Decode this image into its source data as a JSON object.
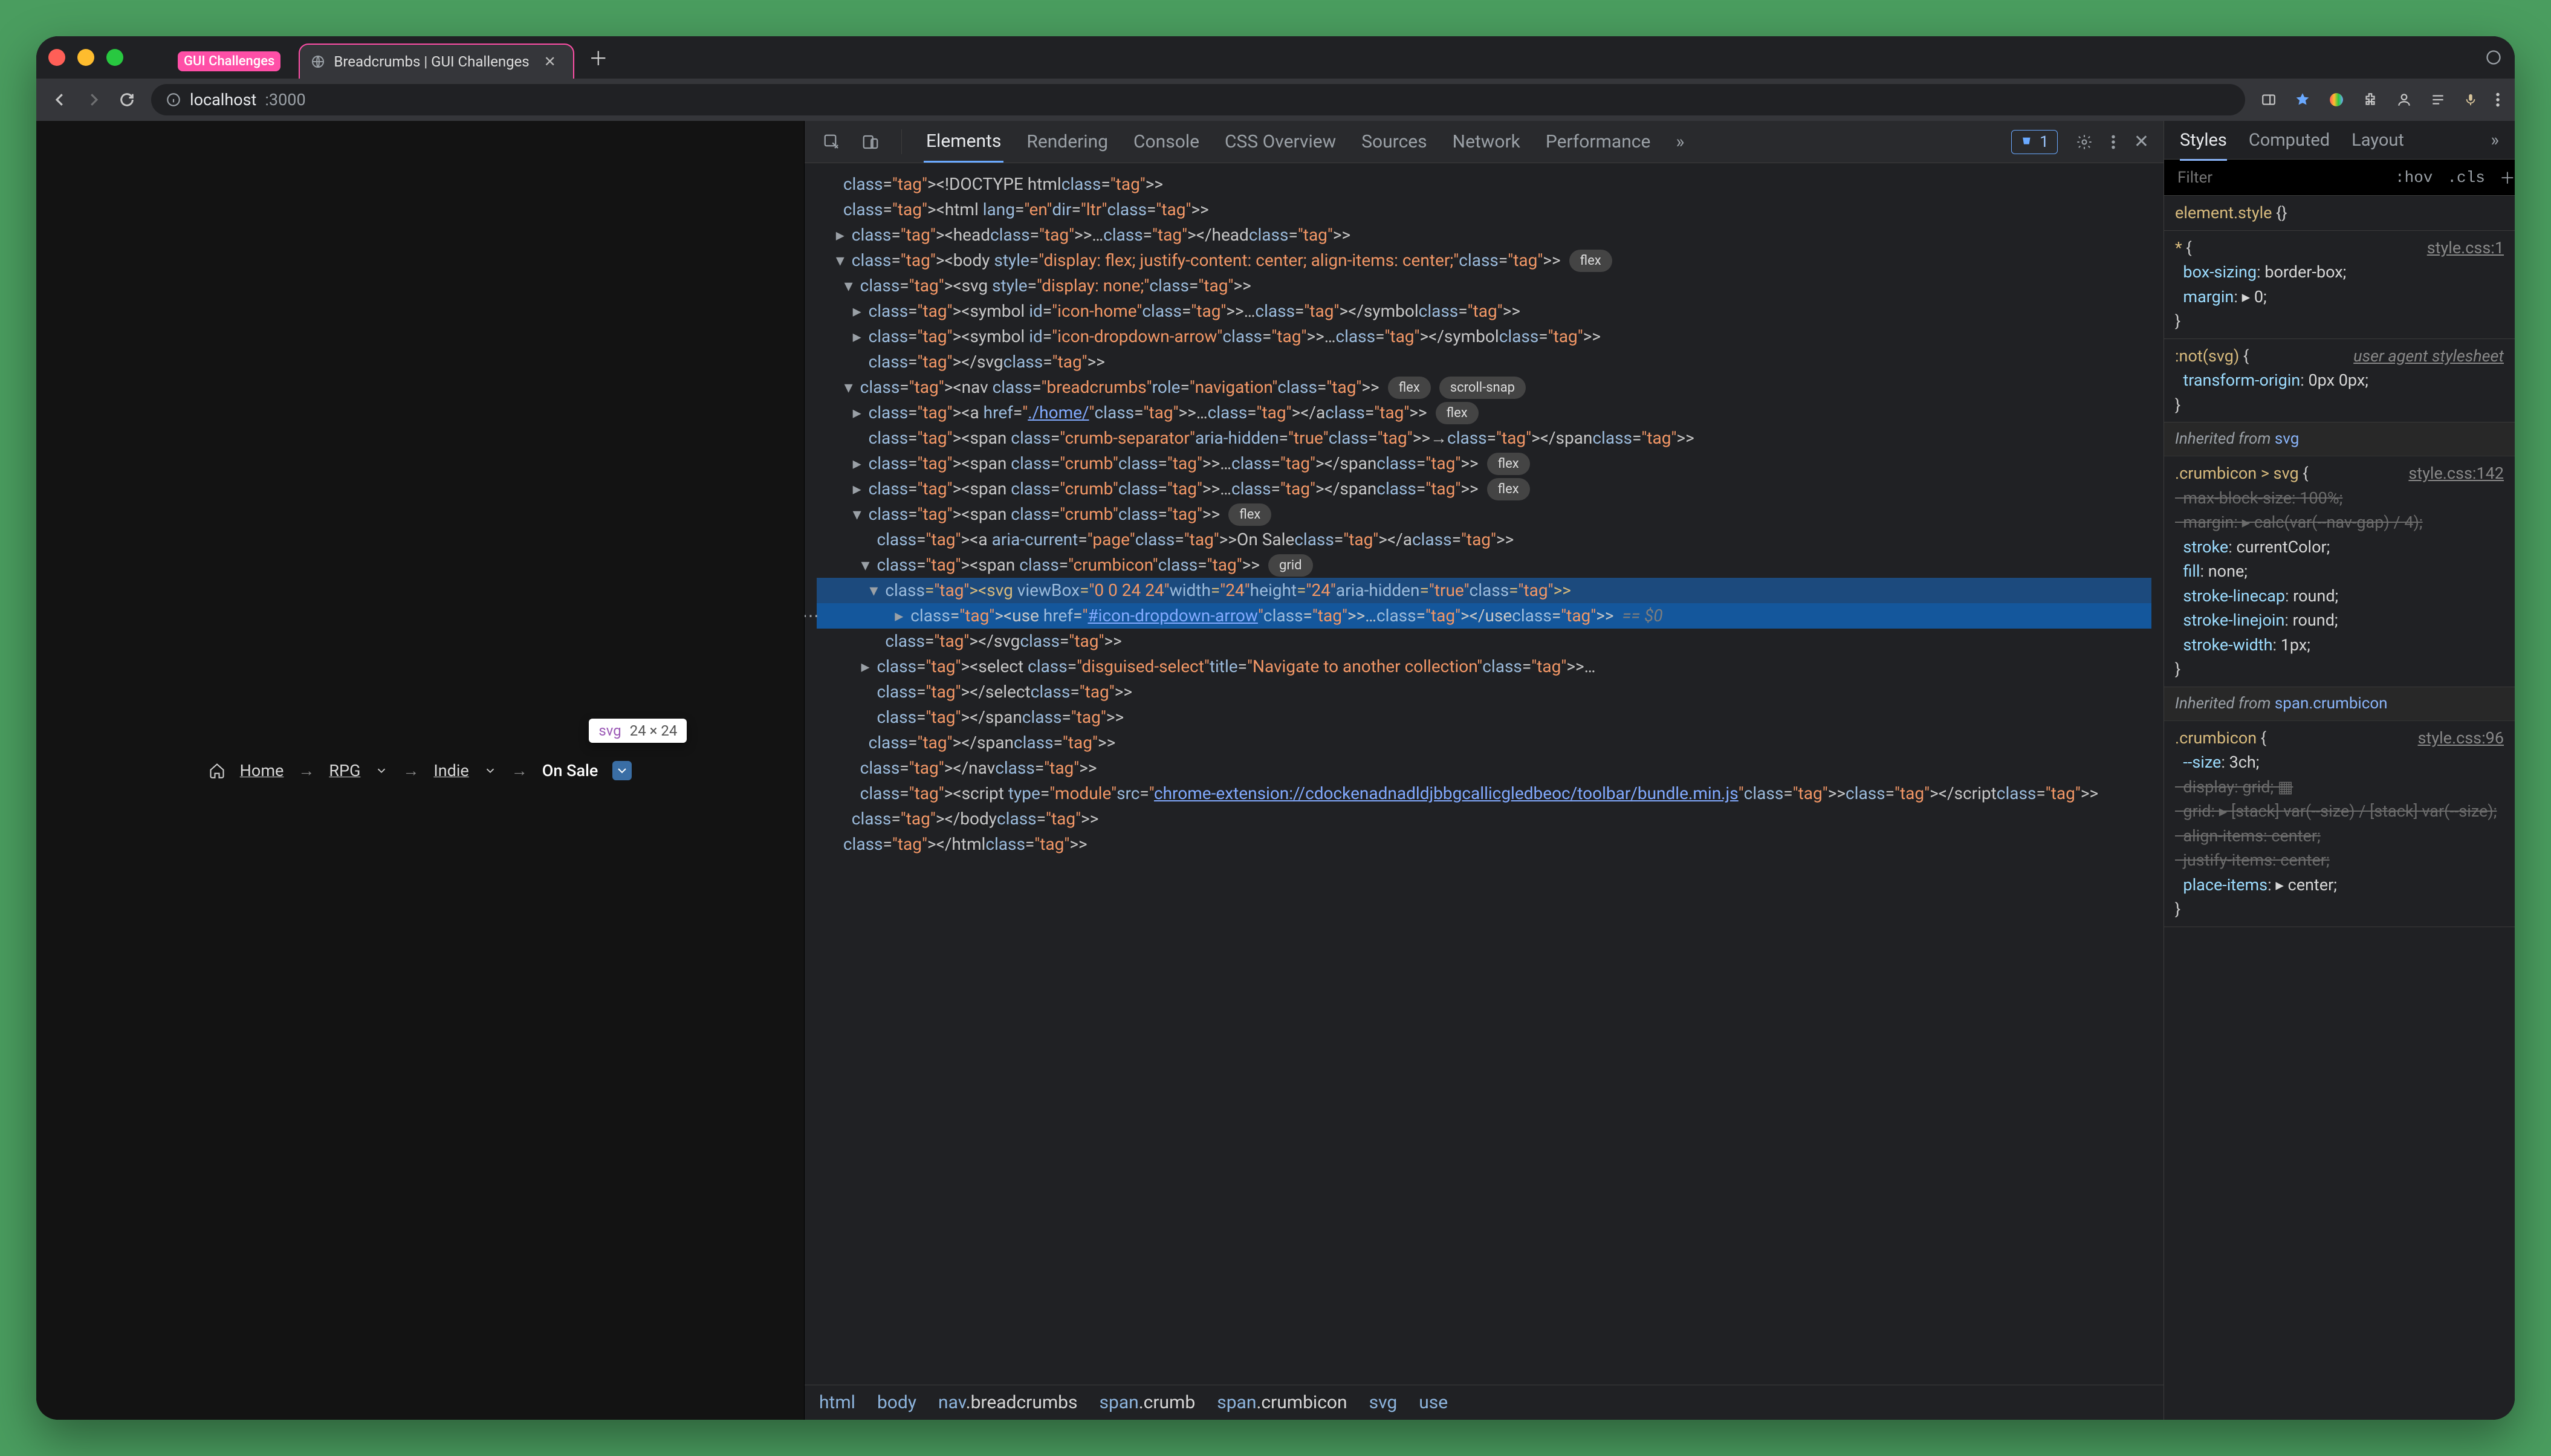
{
  "traffic_colors": [
    "#ff5f57",
    "#febc2e",
    "#28c840"
  ],
  "tabs": [
    {
      "badge_label": "GUI Challenges",
      "active": false
    },
    {
      "label": "Breadcrumbs | GUI Challenges",
      "active": true
    }
  ],
  "address": {
    "protocol_icon": "info",
    "host": "localhost",
    "port": ":3000"
  },
  "toolbar_icons": [
    "panel",
    "star",
    "color-wheel",
    "extensions",
    "profile",
    "reading-list",
    "mic",
    "more"
  ],
  "page": {
    "hover_tip": {
      "element": "svg",
      "dims": "24 × 24"
    },
    "breadcrumbs": {
      "home": "Home",
      "items": [
        "RPG",
        "Indie"
      ],
      "current": "On Sale"
    }
  },
  "devtools": {
    "tabs": [
      "Elements",
      "Rendering",
      "Console",
      "CSS Overview",
      "Sources",
      "Network",
      "Performance"
    ],
    "active_tab": "Elements",
    "issues_count": "1",
    "dom_lines": [
      {
        "indent": 0,
        "pre": "",
        "html": "<!DOCTYPE html>"
      },
      {
        "indent": 0,
        "pre": "",
        "html": "<html lang=\"en\" dir=\"ltr\">"
      },
      {
        "indent": 1,
        "pre": "▸",
        "html": "<head>…</head>"
      },
      {
        "indent": 1,
        "pre": "▾",
        "html": "<body style=\"display: flex; justify-content: center; align-items: center;\">",
        "pills": [
          "flex"
        ]
      },
      {
        "indent": 2,
        "pre": "▾",
        "html": "<svg style=\"display: none;\">"
      },
      {
        "indent": 3,
        "pre": "▸",
        "html": "<symbol id=\"icon-home\">…</symbol>"
      },
      {
        "indent": 3,
        "pre": "▸",
        "html": "<symbol id=\"icon-dropdown-arrow\">…</symbol>"
      },
      {
        "indent": 3,
        "pre": "",
        "html": "</svg>"
      },
      {
        "indent": 2,
        "pre": "▾",
        "html": "<nav class=\"breadcrumbs\" role=\"navigation\">",
        "pills": [
          "flex",
          "scroll-snap"
        ]
      },
      {
        "indent": 3,
        "pre": "▸",
        "html": "<a href=\"./home/\">…</a>",
        "pills": [
          "flex"
        ],
        "link": "./home/"
      },
      {
        "indent": 3,
        "pre": "",
        "html": "<span class=\"crumb-separator\" aria-hidden=\"true\">→</span>"
      },
      {
        "indent": 3,
        "pre": "▸",
        "html": "<span class=\"crumb\">…</span>",
        "pills": [
          "flex"
        ]
      },
      {
        "indent": 3,
        "pre": "▸",
        "html": "<span class=\"crumb\">…</span>",
        "pills": [
          "flex"
        ]
      },
      {
        "indent": 3,
        "pre": "▾",
        "html": "<span class=\"crumb\">",
        "pills": [
          "flex"
        ]
      },
      {
        "indent": 4,
        "pre": "",
        "html": "<a aria-current=\"page\">On Sale</a>"
      },
      {
        "indent": 4,
        "pre": "▾",
        "html": "<span class=\"crumbicon\">",
        "pills": [
          "grid"
        ]
      },
      {
        "indent": 5,
        "pre": "▾",
        "html": "<svg viewBox=\"0 0 24 24\" width=\"24\" height=\"24\" aria-hidden=\"true\">",
        "sel": true
      },
      {
        "indent": 6,
        "pre": "▸",
        "html": "<use href=\"#icon-dropdown-arrow\">…</use>  == $0",
        "sel_strong": true,
        "link": "#icon-dropdown-arrow",
        "gutter": "⋯"
      },
      {
        "indent": 5,
        "pre": "",
        "html": "</svg>"
      },
      {
        "indent": 4,
        "pre": "▸",
        "html": "<select class=\"disguised-select\" title=\"Navigate to another collection\">…"
      },
      {
        "indent": 4,
        "pre": "",
        "html": "</select>"
      },
      {
        "indent": 4,
        "pre": "",
        "html": "</span>"
      },
      {
        "indent": 3,
        "pre": "",
        "html": "</span>"
      },
      {
        "indent": 2,
        "pre": "",
        "html": "</nav>"
      },
      {
        "indent": 2,
        "pre": "",
        "html": "<script type=\"module\" src=\"chrome-extension://cdockenadnadldjbbgcallicgledbeoc/toolbar/bundle.min.js\"></script>",
        "link": "chrome-extension://cdockenadnadldjbbgcallicgledbeoc/toolbar/bundle.min.js"
      },
      {
        "indent": 1,
        "pre": "",
        "html": "</body>"
      },
      {
        "indent": 0,
        "pre": "",
        "html": "</html>"
      }
    ],
    "path": [
      "html",
      "body",
      "nav.breadcrumbs",
      "span.crumb",
      "span.crumbicon",
      "svg",
      "use"
    ]
  },
  "styles": {
    "tabs": [
      "Styles",
      "Computed",
      "Layout"
    ],
    "active": "Styles",
    "filter_placeholder": "Filter",
    "hov": ":hov",
    "cls": ".cls",
    "rules": [
      {
        "selector": "element.style",
        "src": "",
        "decls": []
      },
      {
        "selector": "*",
        "src": "style.css:1",
        "decls": [
          {
            "prop": "box-sizing",
            "val": "border-box;"
          },
          {
            "prop": "margin",
            "val": "▸ 0;"
          }
        ]
      },
      {
        "selector": ":not(svg)",
        "src": "user agent stylesheet",
        "ua": true,
        "decls": [
          {
            "prop": "transform-origin",
            "val": "0px 0px;"
          }
        ]
      }
    ],
    "inherited": [
      {
        "from": "svg",
        "selector": ".crumbicon > svg",
        "src": "style.css:142",
        "decls": [
          {
            "prop": "max-block-size",
            "val": "100%;",
            "struck": true
          },
          {
            "prop": "margin",
            "val": "▸ calc(var(--nav-gap) / 4);",
            "struck": true
          },
          {
            "prop": "stroke",
            "val": "currentColor;"
          },
          {
            "prop": "fill",
            "val": "none;"
          },
          {
            "prop": "stroke-linecap",
            "val": "round;"
          },
          {
            "prop": "stroke-linejoin",
            "val": "round;"
          },
          {
            "prop": "stroke-width",
            "val": "1px;"
          }
        ]
      },
      {
        "from": "span.crumbicon",
        "selector": ".crumbicon",
        "src": "style.css:96",
        "decls": [
          {
            "prop": "--size",
            "val": "3ch;"
          },
          {
            "prop": "display",
            "val": "grid; ▦",
            "struck": true
          },
          {
            "prop": "grid",
            "val": "▸ [stack] var(--size) / [stack] var(--size);",
            "struck": true
          },
          {
            "prop": "align-items",
            "val": "center;",
            "struck": true
          },
          {
            "prop": "justify-items",
            "val": "center;",
            "struck": true
          },
          {
            "prop": "place-items",
            "val": "▸ center;"
          }
        ]
      }
    ]
  }
}
